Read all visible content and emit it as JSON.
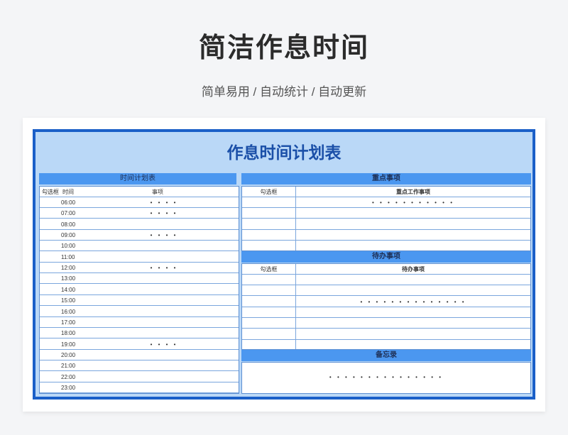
{
  "hero": {
    "title": "简洁作息时间",
    "subtitle": "简单易用 / 自动统计 / 自动更新"
  },
  "sheet": {
    "title": "作息时间计划表",
    "schedule": {
      "header": "时间计划表",
      "col_check": "勾选框",
      "col_time": "时间",
      "col_item": "事项",
      "rows": [
        {
          "time": "06:00",
          "item": "• • • •"
        },
        {
          "time": "07:00",
          "item": "• • • •"
        },
        {
          "time": "08:00",
          "item": ""
        },
        {
          "time": "09:00",
          "item": "• • • •"
        },
        {
          "time": "10:00",
          "item": ""
        },
        {
          "time": "11:00",
          "item": ""
        },
        {
          "time": "12:00",
          "item": "• • • •"
        },
        {
          "time": "13:00",
          "item": ""
        },
        {
          "time": "14:00",
          "item": ""
        },
        {
          "time": "15:00",
          "item": ""
        },
        {
          "time": "16:00",
          "item": ""
        },
        {
          "time": "17:00",
          "item": ""
        },
        {
          "time": "18:00",
          "item": ""
        },
        {
          "time": "19:00",
          "item": "• • • •"
        },
        {
          "time": "20:00",
          "item": ""
        },
        {
          "time": "21:00",
          "item": ""
        },
        {
          "time": "22:00",
          "item": ""
        },
        {
          "time": "23:00",
          "item": ""
        }
      ]
    },
    "key_items": {
      "header": "重点事项",
      "col_check": "勾选框",
      "col_item": "重点工作事项",
      "rows": [
        "• • • • • • • • • • •",
        "",
        "",
        "",
        ""
      ]
    },
    "todo": {
      "header": "待办事项",
      "col_check": "勾选框",
      "col_item": "待办事项",
      "rows": [
        "",
        "",
        "• • • • • • • • • • • • • •",
        "",
        "",
        "",
        ""
      ]
    },
    "memo": {
      "header": "备忘录",
      "content": "• • • • • • • • • • • • • • •"
    }
  }
}
